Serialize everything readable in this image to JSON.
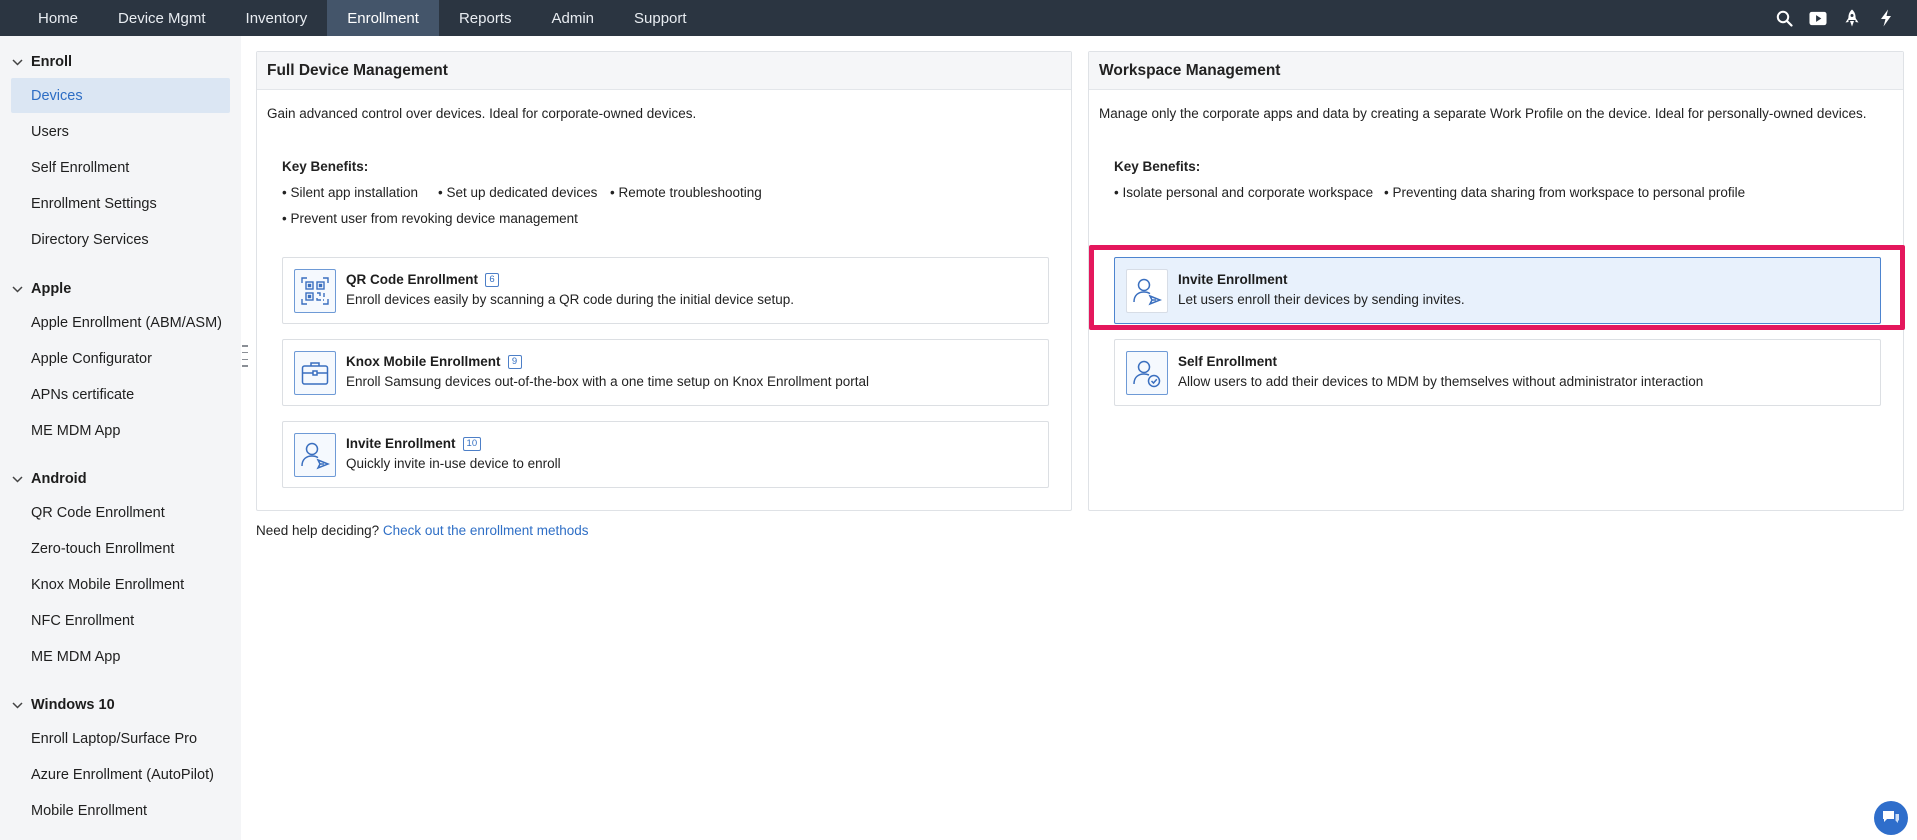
{
  "nav": {
    "items": [
      "Home",
      "Device Mgmt",
      "Inventory",
      "Enrollment",
      "Reports",
      "Admin",
      "Support"
    ],
    "active": "Enrollment",
    "icons": [
      "search-icon",
      "youtube-icon",
      "rocket-icon",
      "flash-icon"
    ]
  },
  "sidebar": {
    "enroll": {
      "label": "Enroll",
      "items": [
        "Devices",
        "Users",
        "Self Enrollment",
        "Enrollment Settings",
        "Directory Services"
      ]
    },
    "apple": {
      "label": "Apple",
      "items": [
        "Apple Enrollment (ABM/ASM)",
        "Apple Configurator",
        "APNs certificate",
        "ME MDM App"
      ]
    },
    "android": {
      "label": "Android",
      "items": [
        "QR Code Enrollment",
        "Zero-touch Enrollment",
        "Knox Mobile Enrollment",
        "NFC Enrollment",
        "ME MDM App"
      ]
    },
    "windows": {
      "label": "Windows 10",
      "items": [
        "Enroll Laptop/Surface Pro",
        "Azure Enrollment (AutoPilot)",
        "Mobile Enrollment"
      ]
    }
  },
  "full": {
    "title": "Full Device Management",
    "desc": "Gain advanced control over devices. Ideal for corporate-owned devices.",
    "benefits_title": "Key Benefits:",
    "benefits": [
      "• Silent app installation",
      "• Set up dedicated devices",
      "• Remote troubleshooting",
      "• Prevent user from revoking device management"
    ],
    "cards": [
      {
        "title": "QR Code Enrollment",
        "badge": "6",
        "desc": "Enroll devices easily by scanning a QR code during the initial device setup.",
        "icon": "qr-code-icon"
      },
      {
        "title": "Knox Mobile Enrollment",
        "badge": "9",
        "desc": "Enroll Samsung devices out-of-the-box with a one time setup on Knox Enrollment portal",
        "icon": "briefcase-icon"
      },
      {
        "title": "Invite Enrollment",
        "badge": "10",
        "desc": "Quickly invite in-use device to enroll",
        "icon": "user-invite-icon"
      }
    ]
  },
  "workspace": {
    "title": "Workspace Management",
    "desc": "Manage only the corporate apps and data by creating a separate Work Profile on the device. Ideal for personally-owned devices.",
    "benefits_title": "Key Benefits:",
    "benefits": [
      "• Isolate personal and corporate workspace",
      "• Preventing data sharing from workspace to personal profile"
    ],
    "cards": [
      {
        "title": "Invite Enrollment",
        "desc": "Let users enroll their devices by sending invites.",
        "icon": "user-invite-icon"
      },
      {
        "title": "Self Enrollment",
        "desc": "Allow users to add their devices to MDM by themselves without administrator interaction",
        "icon": "user-check-icon"
      }
    ]
  },
  "help": {
    "text": "Need help deciding?",
    "link": "Check out the enrollment methods"
  },
  "colors": {
    "topbar": "#2b3541",
    "accent": "#2f6fc6",
    "highlight": "#e4175c",
    "selected": "#e8f1fc"
  }
}
